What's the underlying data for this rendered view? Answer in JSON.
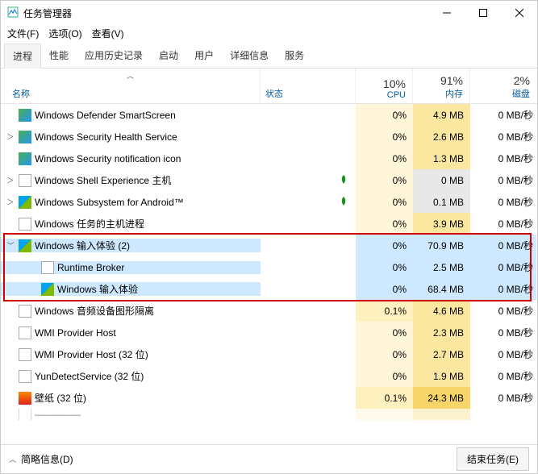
{
  "window": {
    "title": "任务管理器"
  },
  "window_controls": {
    "min": "min",
    "max": "max",
    "close": "close"
  },
  "menubar": [
    {
      "label": "文件(F)"
    },
    {
      "label": "选项(O)"
    },
    {
      "label": "查看(V)"
    }
  ],
  "tabs": [
    {
      "label": "进程",
      "active": true
    },
    {
      "label": "性能"
    },
    {
      "label": "应用历史记录"
    },
    {
      "label": "启动"
    },
    {
      "label": "用户"
    },
    {
      "label": "详细信息"
    },
    {
      "label": "服务"
    }
  ],
  "columns": {
    "name": "名称",
    "status": "状态",
    "cpu_pct": "10%",
    "cpu_lbl": "CPU",
    "mem_pct": "91%",
    "mem_lbl": "内存",
    "disk_pct": "2%",
    "disk_lbl": "磁盘"
  },
  "chart_data": {
    "type": "table",
    "headers_top": {
      "cpu": "10%",
      "memory": "91%",
      "disk": "2%"
    },
    "headers_bottom": {
      "name": "名称",
      "status": "状态",
      "cpu": "CPU",
      "memory": "内存",
      "disk": "磁盘"
    },
    "rows": [
      {
        "name": "Windows Defender SmartScreen",
        "cpu": "0%",
        "memory": "4.9 MB",
        "disk": "0 MB/秒"
      },
      {
        "name": "Windows Security Health Service",
        "cpu": "0%",
        "memory": "2.6 MB",
        "disk": "0 MB/秒"
      },
      {
        "name": "Windows Security notification icon",
        "cpu": "0%",
        "memory": "1.3 MB",
        "disk": "0 MB/秒"
      },
      {
        "name": "Windows Shell Experience 主机",
        "cpu": "0%",
        "memory": "0 MB",
        "disk": "0 MB/秒",
        "suspended": true
      },
      {
        "name": "Windows Subsystem for Android™",
        "cpu": "0%",
        "memory": "0.1 MB",
        "disk": "0 MB/秒",
        "suspended": true
      },
      {
        "name": "Windows 任务的主机进程",
        "cpu": "0%",
        "memory": "3.9 MB",
        "disk": "0 MB/秒"
      },
      {
        "name": "Windows 输入体验 (2)",
        "cpu": "0%",
        "memory": "70.9 MB",
        "disk": "0 MB/秒",
        "expanded": true,
        "children": [
          {
            "name": "Runtime Broker",
            "cpu": "0%",
            "memory": "2.5 MB",
            "disk": "0 MB/秒"
          },
          {
            "name": "Windows 输入体验",
            "cpu": "0%",
            "memory": "68.4 MB",
            "disk": "0 MB/秒"
          }
        ]
      },
      {
        "name": "Windows 音频设备图形隔离",
        "cpu": "0.1%",
        "memory": "4.6 MB",
        "disk": "0 MB/秒"
      },
      {
        "name": "WMI Provider Host",
        "cpu": "0%",
        "memory": "2.3 MB",
        "disk": "0 MB/秒"
      },
      {
        "name": "WMI Provider Host (32 位)",
        "cpu": "0%",
        "memory": "2.7 MB",
        "disk": "0 MB/秒"
      },
      {
        "name": "YunDetectService (32 位)",
        "cpu": "0%",
        "memory": "1.9 MB",
        "disk": "0 MB/秒"
      },
      {
        "name": "壁纸 (32 位)",
        "cpu": "0.1%",
        "memory": "24.3 MB",
        "disk": "0 MB/秒"
      }
    ]
  },
  "processes": [
    {
      "name": "Windows Defender SmartScreen",
      "icon": "shield",
      "expand": "none",
      "leaf": false,
      "cpu": "0%",
      "cpu_tint": "cpu-tint",
      "mem": "4.9 MB",
      "mem_tint": "mem-tint-1",
      "disk": "0 MB/秒"
    },
    {
      "name": "Windows Security Health Service",
      "icon": "shield",
      "expand": "collapsed",
      "leaf": false,
      "cpu": "0%",
      "cpu_tint": "cpu-tint",
      "mem": "2.6 MB",
      "mem_tint": "mem-tint-1",
      "disk": "0 MB/秒"
    },
    {
      "name": "Windows Security notification icon",
      "icon": "shield",
      "expand": "none",
      "leaf": false,
      "cpu": "0%",
      "cpu_tint": "cpu-tint",
      "mem": "1.3 MB",
      "mem_tint": "mem-tint-1",
      "disk": "0 MB/秒"
    },
    {
      "name": "Windows Shell Experience 主机",
      "icon": "gear",
      "expand": "collapsed",
      "leaf": true,
      "cpu": "0%",
      "cpu_tint": "cpu-tint",
      "mem": "0 MB",
      "mem_tint": "mem-tint-0",
      "disk": "0 MB/秒"
    },
    {
      "name": "Windows Subsystem for Android™",
      "icon": "win",
      "expand": "collapsed",
      "leaf": true,
      "cpu": "0%",
      "cpu_tint": "cpu-tint",
      "mem": "0.1 MB",
      "mem_tint": "mem-tint-0",
      "disk": "0 MB/秒"
    },
    {
      "name": "Windows 任务的主机进程",
      "icon": "gear",
      "expand": "none",
      "leaf": false,
      "cpu": "0%",
      "cpu_tint": "cpu-tint",
      "mem": "3.9 MB",
      "mem_tint": "mem-tint-1",
      "disk": "0 MB/秒"
    },
    {
      "name": "Windows 输入体验 (2)",
      "icon": "win",
      "expand": "expanded",
      "leaf": false,
      "cpu": "0%",
      "cpu_tint": "cpu-tint",
      "mem": "70.9 MB",
      "mem_tint": "mem-tint-3",
      "disk": "0 MB/秒",
      "selected": true
    },
    {
      "name": "Runtime Broker",
      "icon": "gear",
      "child": true,
      "expand": "none",
      "leaf": false,
      "cpu": "0%",
      "cpu_tint": "cpu-tint",
      "mem": "2.5 MB",
      "mem_tint": "mem-tint-1",
      "disk": "0 MB/秒",
      "selected": true
    },
    {
      "name": "Windows 输入体验",
      "icon": "win",
      "child": true,
      "expand": "none",
      "leaf": false,
      "cpu": "0%",
      "cpu_tint": "cpu-tint",
      "mem": "68.4 MB",
      "mem_tint": "mem-tint-3",
      "disk": "0 MB/秒",
      "selected": true
    },
    {
      "name": "Windows 音频设备图形隔离",
      "icon": "gear",
      "expand": "none",
      "leaf": false,
      "cpu": "0.1%",
      "cpu_tint": "cpu-tint-1",
      "mem": "4.6 MB",
      "mem_tint": "mem-tint-1",
      "disk": "0 MB/秒"
    },
    {
      "name": "WMI Provider Host",
      "icon": "gear",
      "expand": "none",
      "leaf": false,
      "cpu": "0%",
      "cpu_tint": "cpu-tint",
      "mem": "2.3 MB",
      "mem_tint": "mem-tint-1",
      "disk": "0 MB/秒"
    },
    {
      "name": "WMI Provider Host (32 位)",
      "icon": "gear",
      "expand": "none",
      "leaf": false,
      "cpu": "0%",
      "cpu_tint": "cpu-tint",
      "mem": "2.7 MB",
      "mem_tint": "mem-tint-1",
      "disk": "0 MB/秒"
    },
    {
      "name": "YunDetectService (32 位)",
      "icon": "gear",
      "expand": "none",
      "leaf": false,
      "cpu": "0%",
      "cpu_tint": "cpu-tint",
      "mem": "1.9 MB",
      "mem_tint": "mem-tint-1",
      "disk": "0 MB/秒"
    },
    {
      "name": "壁纸 (32 位)",
      "icon": "wallpaper",
      "expand": "none",
      "leaf": false,
      "cpu": "0.1%",
      "cpu_tint": "cpu-tint-1",
      "mem": "24.3 MB",
      "mem_tint": "mem-tint-2",
      "disk": "0 MB/秒"
    }
  ],
  "cutoff_row": {
    "name": "————————"
  },
  "footer": {
    "less_details": "简略信息(D)",
    "end_task": "结束任务(E)"
  }
}
